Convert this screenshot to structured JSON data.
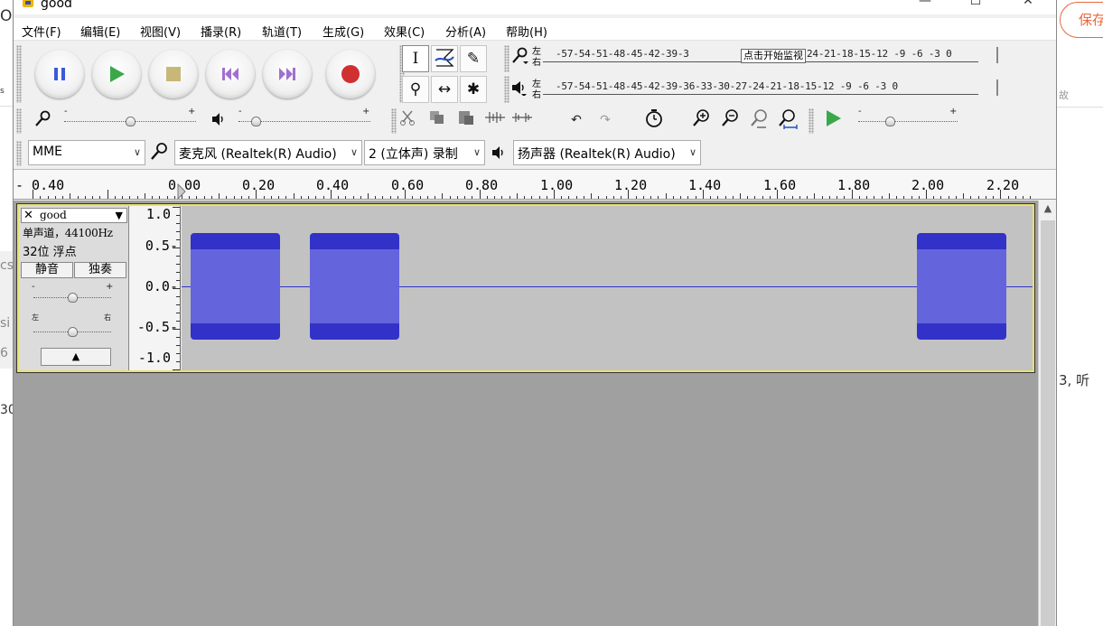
{
  "background_page": {
    "left_fragments": [
      "O",
      "s",
      "cs",
      "si",
      "6",
      "30"
    ],
    "right_fragments": [
      "故",
      "3, 听"
    ],
    "save_button_label": "保存"
  },
  "window": {
    "title": "good",
    "controls": {
      "minimize": "—",
      "maximize": "☐",
      "close": "✕"
    }
  },
  "menu": [
    "文件(F)",
    "编辑(E)",
    "视图(V)",
    "播录(R)",
    "轨道(T)",
    "生成(G)",
    "效果(C)",
    "分析(A)",
    "帮助(H)"
  ],
  "transport": {
    "pause_icon": "pause-icon",
    "play_icon": "play-icon",
    "stop_icon": "stop-icon",
    "skip_start_icon": "skip-start-icon",
    "skip_end_icon": "skip-end-icon",
    "record_icon": "record-icon",
    "colors": {
      "pause": "#3a5bd9",
      "play": "#3aa84a",
      "stop": "#c8b878",
      "skip": "#a070d0",
      "record": "#d03030"
    }
  },
  "tools": {
    "selection": "I",
    "envelope": "envelope-icon",
    "draw": "✎",
    "zoom": "⚲",
    "timeshift": "↔",
    "multi": "✱"
  },
  "meters": {
    "record_label_left": "左",
    "record_label_right": "右",
    "playback_label_left": "左",
    "playback_label_right": "右",
    "record_scale": "-57-54-51-48-45-42-39-3",
    "record_scale_tail": "24-21-18-15-12 -9  -6  -3  0",
    "monitor_tooltip": "点击开始监视",
    "playback_scale": "-57-54-51-48-45-42-39-36-33-30-27-24-21-18-15-12 -9  -6  -3  0"
  },
  "mixer": {
    "slider_minus": "-",
    "slider_plus": "+",
    "record_volume": 0.5,
    "playback_volume": 0.1
  },
  "edit_tools": {
    "cut_icon": "cut-icon",
    "copy_icon": "copy-icon",
    "paste_icon": "paste-icon",
    "trim_icon": "trim-icon",
    "silence_icon": "silence-icon",
    "undo": "↶",
    "redo": "↷",
    "sync_icon": "sync-lock-icon",
    "zoom_in_icon": "zoom-in-icon",
    "zoom_out_icon": "zoom-out-icon",
    "fit_selection_icon": "fit-selection-icon",
    "fit_project_icon": "fit-project-icon",
    "play_at_speed_icon": "play-at-speed-icon",
    "play_speed": 0.3
  },
  "device": {
    "host": "MME",
    "input_device": "麦克风 (Realtek(R) Audio)",
    "channels": "2 (立体声) 录制",
    "output_device": "扬声器 (Realtek(R) Audio)"
  },
  "ruler": {
    "labels": [
      "- 0.40",
      "0.00",
      "0.20",
      "0.40",
      "0.60",
      "0.80",
      "1.00",
      "1.20",
      "1.40",
      "1.60",
      "1.80",
      "2.00",
      "2.20"
    ]
  },
  "track": {
    "close": "✕",
    "name": "good",
    "menu_arrow": "▼",
    "info_line1": "单声道，44100Hz",
    "info_line2": "32位 浮点",
    "mute_label": "静音",
    "solo_label": "独奏",
    "gain_minus": "-",
    "gain_plus": "+",
    "pan_left": "左",
    "pan_right": "右",
    "gain_value": 0.5,
    "pan_value": 0.5,
    "collapse_arrow": "▲",
    "vruler_labels": [
      "1.0",
      "0.5-",
      "0.0-",
      "-0.5-",
      "-1.0"
    ]
  },
  "waveform": {
    "clips": [
      {
        "start": 0.01,
        "end": 0.25,
        "peak": 0.66,
        "rms": 0.46
      },
      {
        "start": 0.33,
        "end": 0.57,
        "peak": 0.66,
        "rms": 0.46
      },
      {
        "start": 1.96,
        "end": 2.2,
        "peak": 0.66,
        "rms": 0.46
      }
    ],
    "waveform_color": "#3232c8",
    "rms_color": "#6464dc",
    "background_color": "#c2c2c2"
  },
  "scrollbar": {
    "up_arrow": "▲"
  }
}
